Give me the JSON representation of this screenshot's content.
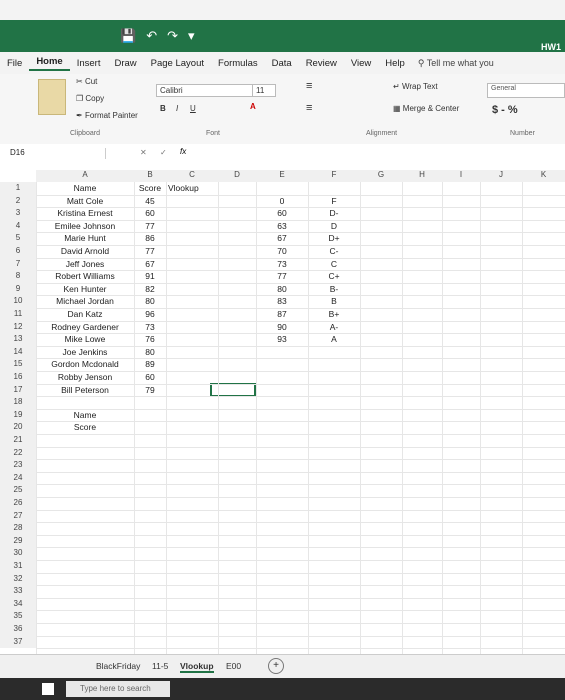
{
  "title_bar": {
    "doc_title": "HW1"
  },
  "tabs": [
    "File",
    "Home",
    "Insert",
    "Draw",
    "Page Layout",
    "Formulas",
    "Data",
    "Review",
    "View",
    "Help"
  ],
  "tell_me": "Tell me what you",
  "ribbon": {
    "cut": "Cut",
    "copy": "Copy",
    "format_painter": "Format Painter",
    "clipboard": "Clipboard",
    "font_name": "Calibri",
    "font_size": "11",
    "font_group": "Font",
    "bold": "B",
    "italic": "I",
    "underline": "U",
    "wrap_text": "Wrap Text",
    "merge_center": "Merge & Center",
    "alignment": "Alignment",
    "number_format": "General",
    "number_group": "Number",
    "currency": "$ - %"
  },
  "formula_bar": {
    "name_box": "D16",
    "fx": "fx"
  },
  "columns": [
    "A",
    "B",
    "C",
    "D",
    "E",
    "F",
    "G",
    "H",
    "I",
    "J",
    "K"
  ],
  "rows": [
    "1",
    "2",
    "3",
    "4",
    "5",
    "6",
    "7",
    "8",
    "9",
    "10",
    "11",
    "12",
    "13",
    "14",
    "15",
    "16",
    "17",
    "18",
    "19",
    "20",
    "21",
    "22",
    "23",
    "24",
    "25",
    "26",
    "27",
    "28",
    "29",
    "30",
    "31",
    "32",
    "33",
    "34",
    "35",
    "36",
    "37"
  ],
  "col_a": [
    "Name",
    "Matt Cole",
    "Kristina Ernest",
    "Emilee Johnson",
    "Marie Hunt",
    "David Arnold",
    "Jeff Jones",
    "Robert Williams",
    "Ken Hunter",
    "Michael Jordan",
    "Dan Katz",
    "Rodney Gardener",
    "Mike Lowe",
    "Joe Jenkins",
    "Gordon Mcdonald",
    "Robby Jenson",
    "Bill Peterson",
    "",
    "Name",
    "Score"
  ],
  "col_b": [
    "Score",
    "45",
    "60",
    "77",
    "86",
    "77",
    "67",
    "91",
    "82",
    "80",
    "96",
    "73",
    "76",
    "80",
    "89",
    "60",
    "79"
  ],
  "col_c_header": "Vlookup",
  "col_e": [
    "0",
    "60",
    "63",
    "67",
    "70",
    "73",
    "77",
    "80",
    "83",
    "87",
    "90",
    "93"
  ],
  "col_f": [
    "F",
    "D-",
    "D",
    "D+",
    "C-",
    "C",
    "C+",
    "B-",
    "B",
    "B+",
    "A-",
    "A"
  ],
  "sheet_tabs": [
    "BlackFriday",
    "11-5",
    "Vlookup",
    "E00"
  ],
  "taskbar": {
    "search": "Type here to search"
  }
}
